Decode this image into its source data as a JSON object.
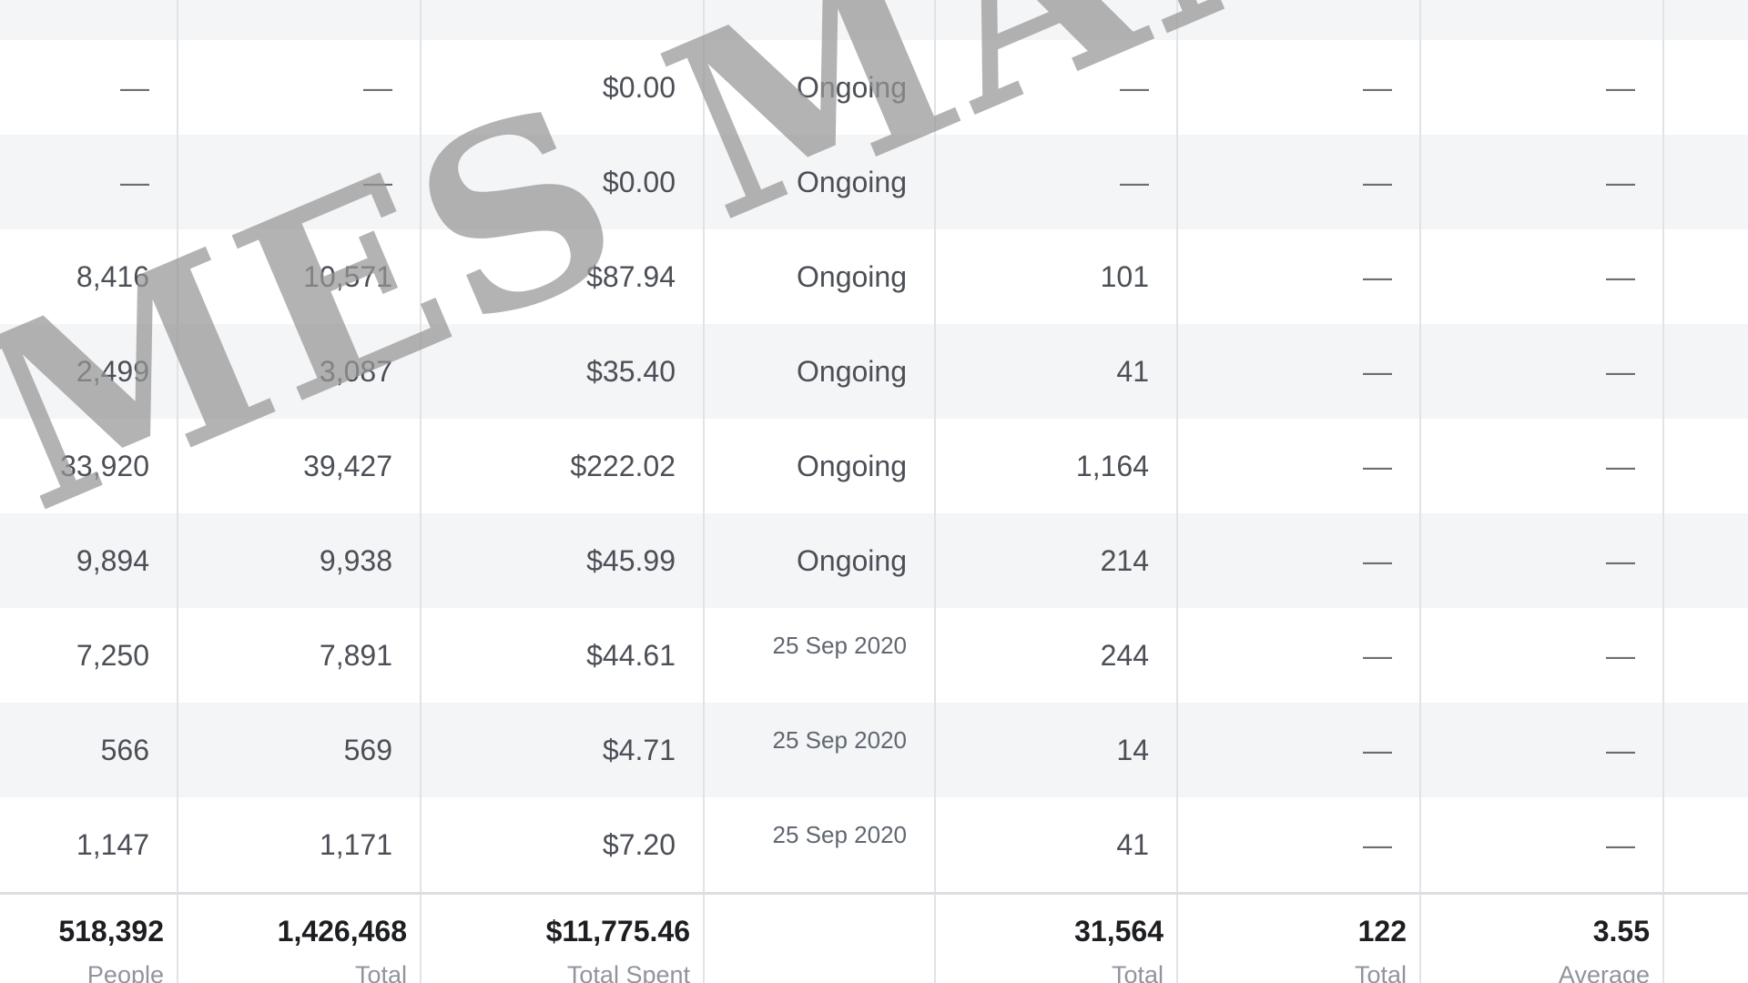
{
  "table": {
    "rows": [
      [
        "—",
        "—",
        "$0.00",
        "Ongoing",
        "—",
        "—",
        "—"
      ],
      [
        "—",
        "—",
        "$0.00",
        "Ongoing",
        "—",
        "—",
        "—"
      ],
      [
        "8,416",
        "10,571",
        "$87.94",
        "Ongoing",
        "101",
        "—",
        "—"
      ],
      [
        "2,499",
        "3,087",
        "$35.40",
        "Ongoing",
        "41",
        "—",
        "—"
      ],
      [
        "33,920",
        "39,427",
        "$222.02",
        "Ongoing",
        "1,164",
        "—",
        "—"
      ],
      [
        "9,894",
        "9,938",
        "$45.99",
        "Ongoing",
        "214",
        "—",
        "—"
      ],
      [
        "7,250",
        "7,891",
        "$44.61",
        "25 Sep 2020",
        "244",
        "—",
        "—"
      ],
      [
        "566",
        "569",
        "$4.71",
        "25 Sep 2020",
        "14",
        "—",
        "—"
      ],
      [
        "1,147",
        "1,171",
        "$7.20",
        "25 Sep 2020",
        "41",
        "—",
        "—"
      ]
    ],
    "totals": [
      {
        "value": "518,392",
        "label": "People"
      },
      {
        "value": "1,426,468",
        "label": "Total"
      },
      {
        "value": "$11,775.46",
        "label": "Total Spent"
      },
      {
        "value": "",
        "label": ""
      },
      {
        "value": "31,564",
        "label": "Total"
      },
      {
        "value": "122",
        "label": "Total"
      },
      {
        "value": "3.55",
        "label": "Average"
      }
    ]
  },
  "watermark": {
    "text": "MES MANLEY"
  },
  "colors": {
    "row_alt": "#f4f5f7",
    "border": "#e1e3e6",
    "text": "#4b4f56",
    "total_text": "#1c1e21",
    "muted": "#90949c"
  }
}
